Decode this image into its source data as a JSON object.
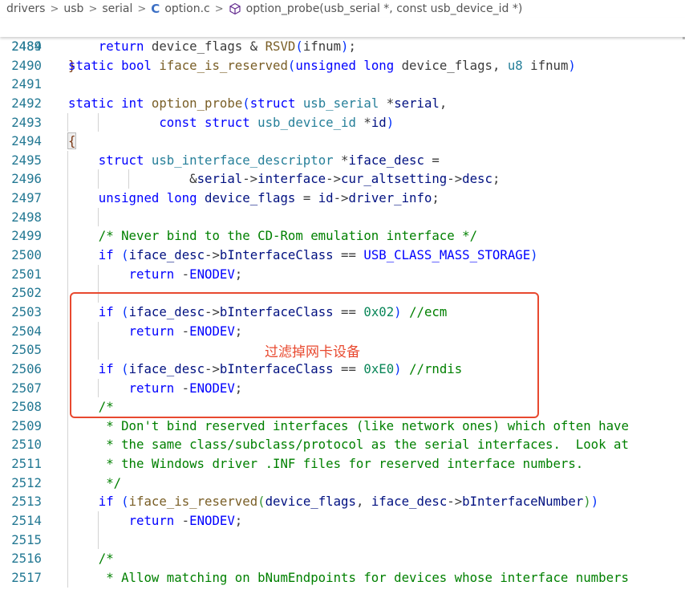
{
  "breadcrumb": {
    "items": [
      "drivers",
      "usb",
      "serial",
      "option.c",
      "option_probe(usb_serial *, const usb_device_id *)"
    ],
    "separator": ">"
  },
  "sticky": {
    "num": "2484",
    "tokens": [
      [
        "kw",
        "static"
      ],
      [
        "pun",
        " "
      ],
      [
        "kw",
        "bool"
      ],
      [
        "pun",
        " "
      ],
      [
        "fn",
        "iface_is_reserved"
      ],
      [
        "br1",
        "("
      ],
      [
        "kw",
        "unsigned"
      ],
      [
        "pun",
        " "
      ],
      [
        "kw",
        "long"
      ],
      [
        "pun",
        " device_flags, "
      ],
      [
        "ty",
        "u8"
      ],
      [
        "pun",
        " ifnum"
      ],
      [
        "br1",
        ")"
      ]
    ]
  },
  "lines": [
    {
      "num": "2489",
      "tokens": [
        [
          "pun",
          "    "
        ],
        [
          "kw",
          "return"
        ],
        [
          "pun",
          " device_flags & "
        ],
        [
          "macfn",
          "RSVD"
        ],
        [
          "br1",
          "("
        ],
        [
          "pun",
          "ifnum"
        ],
        [
          "br1",
          ")"
        ],
        [
          "pun",
          ";"
        ]
      ]
    },
    {
      "num": "2490",
      "tokens": [
        [
          "br3",
          "}"
        ]
      ]
    },
    {
      "num": "2491",
      "tokens": []
    },
    {
      "num": "2492",
      "tokens": [
        [
          "kw",
          "static"
        ],
        [
          "pun",
          " "
        ],
        [
          "kw",
          "int"
        ],
        [
          "pun",
          " "
        ],
        [
          "fn",
          "option_probe"
        ],
        [
          "br1",
          "("
        ],
        [
          "kw",
          "struct"
        ],
        [
          "pun",
          " "
        ],
        [
          "ty",
          "usb_serial"
        ],
        [
          "pun",
          " *"
        ],
        [
          "var",
          "serial"
        ],
        [
          "pun",
          ","
        ]
      ]
    },
    {
      "num": "2493",
      "tokens": [
        [
          "pun",
          "            "
        ],
        [
          "kw",
          "const"
        ],
        [
          "pun",
          " "
        ],
        [
          "kw",
          "struct"
        ],
        [
          "pun",
          " "
        ],
        [
          "ty",
          "usb_device_id"
        ],
        [
          "pun",
          " *"
        ],
        [
          "var",
          "id"
        ],
        [
          "br1",
          ")"
        ]
      ]
    },
    {
      "num": "2494",
      "tokens": [
        [
          "br3",
          "{"
        ]
      ]
    },
    {
      "num": "2495",
      "tokens": [
        [
          "pun",
          "    "
        ],
        [
          "kw",
          "struct"
        ],
        [
          "pun",
          " "
        ],
        [
          "ty",
          "usb_interface_descriptor"
        ],
        [
          "pun",
          " *"
        ],
        [
          "var",
          "iface_desc"
        ],
        [
          "pun",
          " ="
        ]
      ]
    },
    {
      "num": "2496",
      "tokens": [
        [
          "pun",
          "                &"
        ],
        [
          "var",
          "serial"
        ],
        [
          "pun",
          "->"
        ],
        [
          "var",
          "interface"
        ],
        [
          "pun",
          "->"
        ],
        [
          "var",
          "cur_altsetting"
        ],
        [
          "pun",
          "->"
        ],
        [
          "var",
          "desc"
        ],
        [
          "pun",
          ";"
        ]
      ]
    },
    {
      "num": "2497",
      "tokens": [
        [
          "pun",
          "    "
        ],
        [
          "kw",
          "unsigned"
        ],
        [
          "pun",
          " "
        ],
        [
          "kw",
          "long"
        ],
        [
          "pun",
          " "
        ],
        [
          "var",
          "device_flags"
        ],
        [
          "pun",
          " = "
        ],
        [
          "var",
          "id"
        ],
        [
          "pun",
          "->"
        ],
        [
          "var",
          "driver_info"
        ],
        [
          "pun",
          ";"
        ]
      ]
    },
    {
      "num": "2498",
      "tokens": []
    },
    {
      "num": "2499",
      "tokens": [
        [
          "pun",
          "    "
        ],
        [
          "cm",
          "/* Never bind to the CD-Rom emulation interface */"
        ]
      ]
    },
    {
      "num": "2500",
      "tokens": [
        [
          "pun",
          "    "
        ],
        [
          "kw",
          "if"
        ],
        [
          "pun",
          " "
        ],
        [
          "br1",
          "("
        ],
        [
          "var",
          "iface_desc"
        ],
        [
          "pun",
          "->"
        ],
        [
          "var",
          "bInterfaceClass"
        ],
        [
          "pun",
          " == "
        ],
        [
          "mac",
          "USB_CLASS_MASS_STORAGE"
        ],
        [
          "br1",
          ")"
        ]
      ]
    },
    {
      "num": "2501",
      "tokens": [
        [
          "pun",
          "        "
        ],
        [
          "kw",
          "return"
        ],
        [
          "pun",
          " -"
        ],
        [
          "mac",
          "ENODEV"
        ],
        [
          "pun",
          ";"
        ]
      ]
    },
    {
      "num": "2502",
      "tokens": []
    },
    {
      "num": "2503",
      "tokens": [
        [
          "pun",
          "    "
        ],
        [
          "kw",
          "if"
        ],
        [
          "pun",
          " "
        ],
        [
          "br1",
          "("
        ],
        [
          "var",
          "iface_desc"
        ],
        [
          "pun",
          "->"
        ],
        [
          "var",
          "bInterfaceClass"
        ],
        [
          "pun",
          " == "
        ],
        [
          "num",
          "0x02"
        ],
        [
          "br1",
          ")"
        ],
        [
          "pun",
          " "
        ],
        [
          "cm",
          "//ecm"
        ]
      ]
    },
    {
      "num": "2504",
      "tokens": [
        [
          "pun",
          "        "
        ],
        [
          "kw",
          "return"
        ],
        [
          "pun",
          " -"
        ],
        [
          "mac",
          "ENODEV"
        ],
        [
          "pun",
          ";"
        ]
      ]
    },
    {
      "num": "2505",
      "tokens": []
    },
    {
      "num": "2506",
      "tokens": [
        [
          "pun",
          "    "
        ],
        [
          "kw",
          "if"
        ],
        [
          "pun",
          " "
        ],
        [
          "br1",
          "("
        ],
        [
          "var",
          "iface_desc"
        ],
        [
          "pun",
          "->"
        ],
        [
          "var",
          "bInterfaceClass"
        ],
        [
          "pun",
          " == "
        ],
        [
          "num",
          "0xE0"
        ],
        [
          "br1",
          ")"
        ],
        [
          "pun",
          " "
        ],
        [
          "cm",
          "//rndis"
        ]
      ]
    },
    {
      "num": "2507",
      "tokens": [
        [
          "pun",
          "        "
        ],
        [
          "kw",
          "return"
        ],
        [
          "pun",
          " -"
        ],
        [
          "mac",
          "ENODEV"
        ],
        [
          "pun",
          ";"
        ]
      ]
    },
    {
      "num": "2508",
      "tokens": [
        [
          "pun",
          "    "
        ],
        [
          "cm",
          "/*"
        ]
      ]
    },
    {
      "num": "2509",
      "tokens": [
        [
          "pun",
          "    "
        ],
        [
          "cm",
          " * Don't bind reserved interfaces (like network ones) which often have"
        ]
      ]
    },
    {
      "num": "2510",
      "tokens": [
        [
          "pun",
          "    "
        ],
        [
          "cm",
          " * the same class/subclass/protocol as the serial interfaces.  Look at"
        ]
      ]
    },
    {
      "num": "2511",
      "tokens": [
        [
          "pun",
          "    "
        ],
        [
          "cm",
          " * the Windows driver .INF files for reserved interface numbers."
        ]
      ]
    },
    {
      "num": "2512",
      "tokens": [
        [
          "pun",
          "    "
        ],
        [
          "cm",
          " */"
        ]
      ]
    },
    {
      "num": "2513",
      "tokens": [
        [
          "pun",
          "    "
        ],
        [
          "kw",
          "if"
        ],
        [
          "pun",
          " "
        ],
        [
          "br1",
          "("
        ],
        [
          "fn",
          "iface_is_reserved"
        ],
        [
          "br2",
          "("
        ],
        [
          "var",
          "device_flags"
        ],
        [
          "pun",
          ", "
        ],
        [
          "var",
          "iface_desc"
        ],
        [
          "pun",
          "->"
        ],
        [
          "var",
          "bInterfaceNumber"
        ],
        [
          "br2",
          ")"
        ],
        [
          "br1",
          ")"
        ]
      ]
    },
    {
      "num": "2514",
      "tokens": [
        [
          "pun",
          "        "
        ],
        [
          "kw",
          "return"
        ],
        [
          "pun",
          " -"
        ],
        [
          "mac",
          "ENODEV"
        ],
        [
          "pun",
          ";"
        ]
      ]
    },
    {
      "num": "2515",
      "tokens": []
    },
    {
      "num": "2516",
      "tokens": [
        [
          "pun",
          "    "
        ],
        [
          "cm",
          "/*"
        ]
      ]
    },
    {
      "num": "2517",
      "tokens": [
        [
          "pun",
          "    "
        ],
        [
          "cm",
          " * Allow matching on bNumEndpoints for devices whose interface numbers"
        ]
      ]
    }
  ],
  "annotation": {
    "text": "过滤掉网卡设备",
    "color": "#e8492f"
  },
  "colors": {
    "keyword": "#0000ff",
    "type": "#267f99",
    "function": "#795e26",
    "variable": "#001080",
    "comment": "#008000",
    "number": "#098658",
    "line_number": "#237893"
  }
}
